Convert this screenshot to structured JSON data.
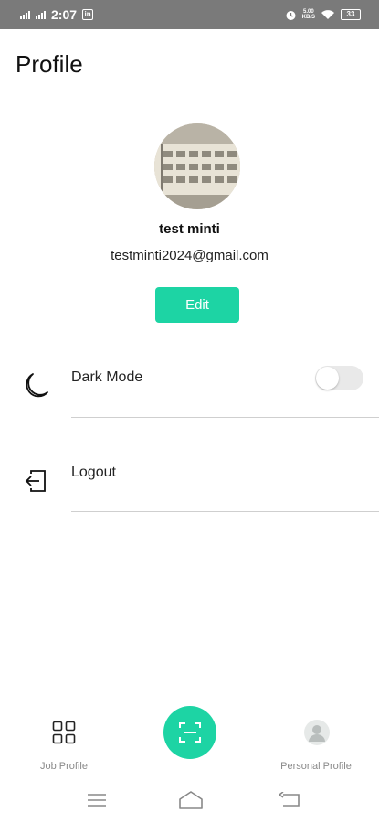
{
  "status_bar": {
    "time": "2:07",
    "app_badge": "in",
    "net_speed_top": "5.00",
    "net_speed_bottom": "KB/S",
    "battery": "33"
  },
  "header": {
    "title": "Profile"
  },
  "profile": {
    "name": "test minti",
    "email": "testminti2024@gmail.com",
    "edit_label": "Edit"
  },
  "settings": {
    "dark_mode": {
      "label": "Dark Mode",
      "icon": "moon-icon",
      "enabled": false
    },
    "logout": {
      "label": "Logout",
      "icon": "logout-icon"
    }
  },
  "bottom_nav": {
    "items": [
      {
        "label": "Job Profile",
        "icon": "grid-icon"
      },
      {
        "label": "",
        "icon": "scan-icon"
      },
      {
        "label": "Personal Profile",
        "icon": "person-icon"
      }
    ]
  },
  "colors": {
    "accent": "#1dd4a4",
    "status_bar_bg": "#7a7a7a",
    "divider": "#cfcfcf",
    "nav_label": "#8a8a8a"
  }
}
